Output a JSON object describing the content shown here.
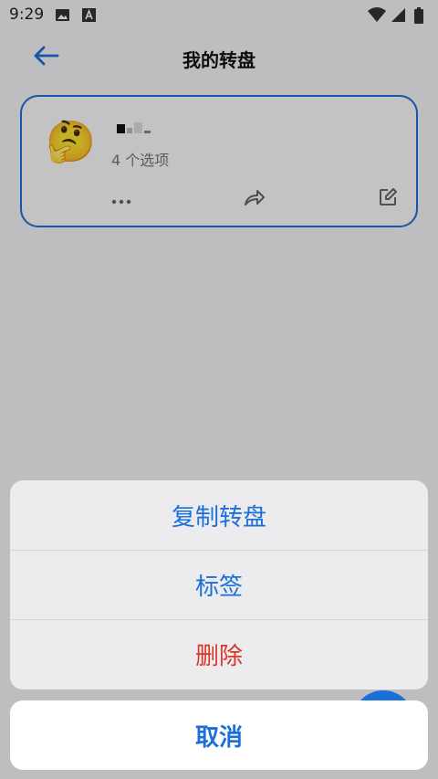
{
  "status_bar": {
    "time": "9:29",
    "icons": [
      "image-icon",
      "a-icon",
      "wifi-icon",
      "signal-icon",
      "battery-icon"
    ]
  },
  "header": {
    "title": "我的转盘",
    "back_icon": "back-arrow-icon"
  },
  "wheel_card": {
    "emoji": "🤔",
    "options_count": "4 个选项",
    "actions": [
      "more-icon",
      "share-icon",
      "edit-icon"
    ]
  },
  "action_sheet": {
    "items": [
      {
        "label": "复制转盘",
        "style": "normal"
      },
      {
        "label": "标签",
        "style": "normal"
      },
      {
        "label": "删除",
        "style": "danger"
      }
    ],
    "cancel_label": "取消"
  },
  "colors": {
    "accent": "#1a6fd9",
    "danger": "#d9362b",
    "scrim": "rgba(0,0,0,0.22)"
  }
}
